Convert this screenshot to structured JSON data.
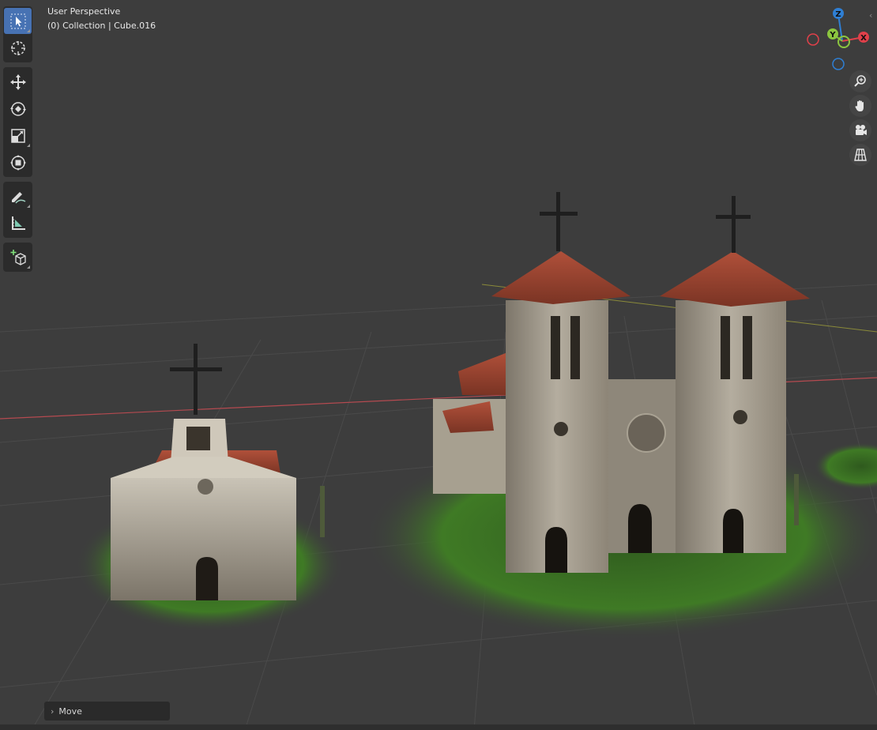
{
  "viewport": {
    "view_name": "User Perspective",
    "collection_info": "(0) Collection | Cube.016"
  },
  "toolbar": {
    "tools": [
      {
        "name": "select-box",
        "icon": "cursor-arrow-icon",
        "active": true
      },
      {
        "name": "cursor",
        "icon": "3d-cursor-icon",
        "active": false
      },
      {
        "name": "move",
        "icon": "move-arrows-icon",
        "active": false
      },
      {
        "name": "rotate",
        "icon": "rotate-icon",
        "active": false
      },
      {
        "name": "scale",
        "icon": "scale-icon",
        "active": false
      },
      {
        "name": "transform",
        "icon": "transform-icon",
        "active": false
      },
      {
        "name": "annotate",
        "icon": "pencil-icon",
        "active": false
      },
      {
        "name": "measure",
        "icon": "ruler-icon",
        "active": false
      },
      {
        "name": "add-cube",
        "icon": "add-cube-icon",
        "active": false
      }
    ]
  },
  "gizmo": {
    "axes": {
      "x": "X",
      "y": "Y",
      "z": "Z"
    },
    "colors": {
      "x": "#e0404a",
      "y": "#8cc63f",
      "z": "#2f7fd4"
    }
  },
  "navigation": {
    "icons": [
      "zoom-icon",
      "hand-pan-icon",
      "camera-icon",
      "grid-perspective-icon"
    ]
  },
  "operator_panel": {
    "label": "Move"
  },
  "colors": {
    "viewport_bg": "#3d3d3d",
    "grid_line": "#4a4a4a",
    "x_axis": "#b54a50",
    "y_axis": "#8a8a3a",
    "active_tool": "#4772b3",
    "panel_bg": "#2b2b2b"
  }
}
